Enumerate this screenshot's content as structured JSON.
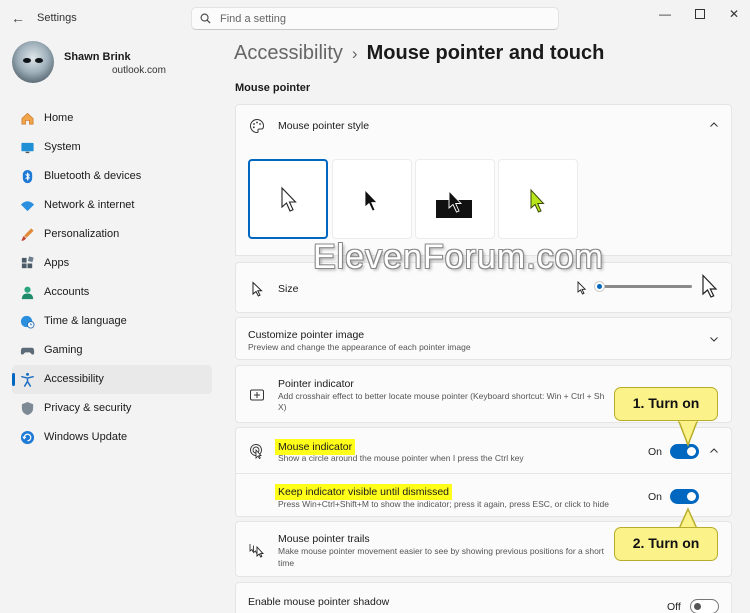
{
  "titlebar": {
    "app_title": "Settings",
    "search_placeholder": "Find a setting"
  },
  "profile": {
    "name": "Shawn Brink",
    "email": "outlook.com"
  },
  "nav": [
    {
      "label": "Home",
      "icon": "home-icon"
    },
    {
      "label": "System",
      "icon": "monitor-icon"
    },
    {
      "label": "Bluetooth & devices",
      "icon": "bluetooth-icon"
    },
    {
      "label": "Network & internet",
      "icon": "wifi-icon"
    },
    {
      "label": "Personalization",
      "icon": "brush-icon"
    },
    {
      "label": "Apps",
      "icon": "apps-icon"
    },
    {
      "label": "Accounts",
      "icon": "person-icon"
    },
    {
      "label": "Time & language",
      "icon": "globe-clock-icon"
    },
    {
      "label": "Gaming",
      "icon": "controller-icon"
    },
    {
      "label": "Accessibility",
      "icon": "accessibility-icon",
      "active": true
    },
    {
      "label": "Privacy & security",
      "icon": "shield-icon"
    },
    {
      "label": "Windows Update",
      "icon": "update-icon"
    }
  ],
  "breadcrumb": {
    "parent": "Accessibility",
    "separator": "›",
    "current": "Mouse pointer and touch"
  },
  "section_title": "Mouse pointer",
  "pointer_style": {
    "title": "Mouse pointer style",
    "selected_index": 0,
    "options": [
      "white",
      "black",
      "inverted",
      "custom"
    ],
    "custom_color": "#b6e61b"
  },
  "size": {
    "title": "Size",
    "value_fraction": 0.0
  },
  "customize": {
    "title": "Customize pointer image",
    "desc": "Preview and change the appearance of each pointer image"
  },
  "pointer_indicator": {
    "title": "Pointer indicator",
    "desc": "Add crosshair effect to better locate mouse pointer (Keyboard shortcut: Win + Ctrl + Sh",
    "desc2": "X)"
  },
  "mouse_indicator": {
    "title": "Mouse indicator",
    "desc": "Show a circle around the mouse pointer when I press the Ctrl key",
    "state": "On"
  },
  "keep_visible": {
    "title": "Keep indicator visible until dismissed",
    "desc": "Press Win+Ctrl+Shift+M to show the indicator; press it again, press ESC, or click to hide",
    "state": "On"
  },
  "trails": {
    "title": "Mouse pointer trails",
    "desc": "Make mouse pointer movement easier to see by showing previous positions for a short",
    "desc2": "time"
  },
  "shadow": {
    "title": "Enable mouse pointer shadow",
    "state": "Off"
  },
  "callouts": {
    "one": "1. Turn on",
    "two": "2. Turn on"
  },
  "watermark": "ElevenForum.com",
  "colors": {
    "accent": "#0067c0",
    "highlight": "#ffff1a",
    "callout": "#fcf28a"
  }
}
